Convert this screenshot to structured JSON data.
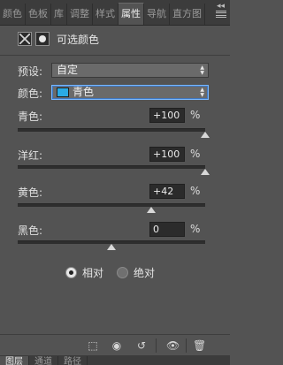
{
  "tabs": [
    {
      "label": "颜色",
      "active": false
    },
    {
      "label": "色板",
      "active": false
    },
    {
      "label": "库",
      "active": false
    },
    {
      "label": "调整",
      "active": false
    },
    {
      "label": "样式",
      "active": false
    },
    {
      "label": "属性",
      "active": true
    },
    {
      "label": "导航",
      "active": false
    },
    {
      "label": "直方图",
      "active": false
    }
  ],
  "header": {
    "title": "可选颜色"
  },
  "preset": {
    "label": "预设:",
    "value": "自定"
  },
  "color": {
    "label": "颜色:",
    "value": "青色",
    "swatch": "#2aaae6"
  },
  "sliders": [
    {
      "label": "青色:",
      "value": "+100",
      "unit": "%",
      "fraction": 1.0
    },
    {
      "label": "洋红:",
      "value": "+100",
      "unit": "%",
      "fraction": 1.0
    },
    {
      "label": "黄色:",
      "value": "+42",
      "unit": "%",
      "fraction": 0.71
    },
    {
      "label": "黑色:",
      "value": "0",
      "unit": "%",
      "fraction": 0.5
    }
  ],
  "method": {
    "relative": "相对",
    "absolute": "绝对",
    "selected": "relative"
  },
  "bottom_tabs": [
    "图层",
    "通道",
    "路径"
  ]
}
